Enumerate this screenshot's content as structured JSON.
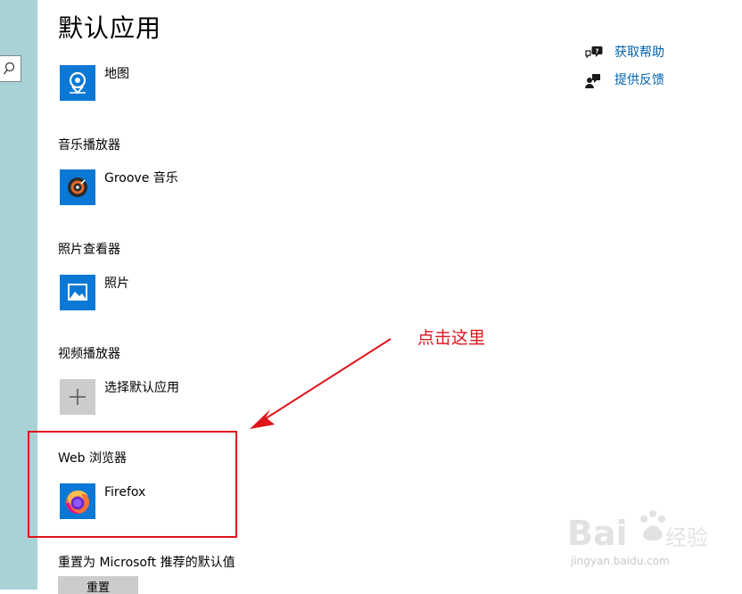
{
  "page_title": "默认应用",
  "help_links": [
    {
      "label": "获取帮助",
      "icon": "help-chat-icon"
    },
    {
      "label": "提供反馈",
      "icon": "feedback-icon"
    }
  ],
  "sections": [
    {
      "label": null,
      "app": "地图",
      "icon": "maps-icon"
    },
    {
      "label": "音乐播放器",
      "app": "Groove 音乐",
      "icon": "groove-music-icon"
    },
    {
      "label": "照片查看器",
      "app": "照片",
      "icon": "photos-icon"
    },
    {
      "label": "视频播放器",
      "app": "选择默认应用",
      "icon": "plus-icon"
    },
    {
      "label": "Web 浏览器",
      "app": "Firefox",
      "icon": "firefox-icon"
    }
  ],
  "reset": {
    "label": "重置为 Microsoft 推荐的默认值",
    "button": "重置"
  },
  "annotation": {
    "text": "点击这里",
    "color": "#e0141b"
  },
  "watermark": {
    "brand": "Baidu经验",
    "url": "jingyan.baidu.com"
  },
  "colors": {
    "accent": "#0a78d4",
    "link": "#0063b1",
    "sidebar": "#a9d2d7"
  }
}
